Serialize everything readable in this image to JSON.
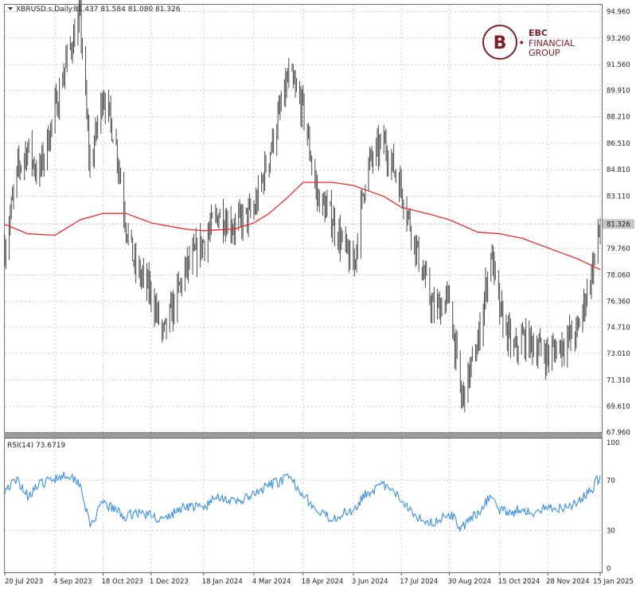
{
  "header": {
    "title": "XBRUSD.s,Daily",
    "ohlc": "81.437 81.584 81.080 81.326"
  },
  "logo": {
    "line1": "EBC",
    "line2": "FINANCIAL",
    "line3": "GROUP"
  },
  "colors": {
    "background": "#ffffff",
    "candles": "#4a4a4a",
    "moving_average": "#e03030",
    "rsi": "#3b8fe0",
    "grid": "#c8c8c8",
    "logo": "#7a1f2b",
    "current_price_tag": "#c6c6c6"
  },
  "chart_data": [
    {
      "type": "line",
      "title": "XBRUSD.s,Daily",
      "current_price_label": "81.326",
      "y_ticks": [
        "94.960",
        "93.260",
        "91.560",
        "89.910",
        "88.210",
        "86.510",
        "84.810",
        "83.110",
        "81.326",
        "79.760",
        "78.060",
        "76.360",
        "74.710",
        "73.010",
        "71.310",
        "69.610",
        "67.960"
      ],
      "ylim": [
        67.96,
        95.4
      ],
      "x_ticks": [
        "20 Jul 2023",
        "4 Sep 2023",
        "18 Oct 2023",
        "1 Dec 2023",
        "18 Jan 2024",
        "4 Mar 2024",
        "18 Apr 2024",
        "3 Jun 2024",
        "17 Jul 2024",
        "30 Aug 2024",
        "15 Oct 2024",
        "28 Nov 2024",
        "15 Jan 2025"
      ],
      "grid": true,
      "series": [
        {
          "name": "",
          "style": "ohlc-bars",
          "x": [
            "2023-07-20",
            "2023-08-01",
            "2023-08-10",
            "2023-08-20",
            "2023-09-04",
            "2023-09-15",
            "2023-09-27",
            "2023-10-06",
            "2023-10-18",
            "2023-10-30",
            "2023-11-08",
            "2023-11-16",
            "2023-12-01",
            "2023-12-12",
            "2024-01-01",
            "2024-01-18",
            "2024-02-01",
            "2024-02-15",
            "2024-03-04",
            "2024-03-18",
            "2024-04-05",
            "2024-04-18",
            "2024-05-01",
            "2024-05-15",
            "2024-06-03",
            "2024-06-15",
            "2024-07-01",
            "2024-07-17",
            "2024-08-01",
            "2024-08-15",
            "2024-08-30",
            "2024-09-10",
            "2024-09-25",
            "2024-10-07",
            "2024-10-15",
            "2024-10-28",
            "2024-11-05",
            "2024-11-15",
            "2024-11-28",
            "2024-12-10",
            "2024-12-25",
            "2025-01-08",
            "2025-01-15"
          ],
          "values": [
            79.8,
            84.8,
            86.2,
            84.4,
            88.6,
            92.0,
            94.6,
            84.9,
            89.8,
            86.4,
            81.3,
            78.6,
            76.9,
            74.1,
            78.3,
            80.2,
            82.0,
            81.2,
            82.1,
            85.8,
            90.8,
            88.7,
            83.1,
            81.6,
            78.4,
            84.9,
            86.6,
            83.6,
            79.4,
            75.8,
            76.5,
            70.0,
            73.6,
            79.6,
            75.7,
            73.1,
            74.0,
            73.6,
            72.9,
            73.6,
            74.4,
            78.5,
            81.3
          ]
        },
        {
          "name": "",
          "style": "moving-average",
          "x": [
            "2023-07-20",
            "2023-08-10",
            "2023-09-04",
            "2023-09-27",
            "2023-10-18",
            "2023-11-08",
            "2023-12-01",
            "2024-01-01",
            "2024-01-18",
            "2024-02-15",
            "2024-03-04",
            "2024-03-18",
            "2024-04-05",
            "2024-04-18",
            "2024-05-15",
            "2024-06-03",
            "2024-07-01",
            "2024-07-17",
            "2024-08-15",
            "2024-08-30",
            "2024-09-25",
            "2024-10-15",
            "2024-11-05",
            "2024-11-28",
            "2024-12-25",
            "2025-01-15"
          ],
          "values": [
            81.3,
            80.7,
            80.6,
            81.6,
            82.0,
            82.0,
            81.4,
            81.0,
            80.9,
            81.0,
            81.4,
            82.0,
            83.1,
            84.0,
            84.0,
            83.8,
            83.1,
            82.4,
            81.9,
            81.6,
            80.8,
            80.7,
            80.4,
            79.8,
            79.1,
            78.4
          ]
        }
      ]
    },
    {
      "type": "line",
      "title": "RSI(14) 73.6719",
      "y_ticks": [
        "100",
        "70",
        "30",
        "0"
      ],
      "ylim": [
        0,
        100
      ],
      "grid": true,
      "series": [
        {
          "name": "",
          "x": [
            "2023-07-20",
            "2023-08-01",
            "2023-08-10",
            "2023-08-20",
            "2023-09-04",
            "2023-09-15",
            "2023-09-27",
            "2023-10-06",
            "2023-10-18",
            "2023-10-30",
            "2023-11-08",
            "2023-11-16",
            "2023-12-01",
            "2023-12-12",
            "2024-01-01",
            "2024-01-18",
            "2024-02-01",
            "2024-02-15",
            "2024-03-04",
            "2024-03-18",
            "2024-04-05",
            "2024-04-18",
            "2024-05-01",
            "2024-05-15",
            "2024-06-03",
            "2024-06-15",
            "2024-07-01",
            "2024-07-17",
            "2024-08-01",
            "2024-08-15",
            "2024-08-30",
            "2024-09-10",
            "2024-09-25",
            "2024-10-07",
            "2024-10-15",
            "2024-10-28",
            "2024-11-05",
            "2024-11-15",
            "2024-11-28",
            "2024-12-10",
            "2024-12-25",
            "2025-01-08",
            "2025-01-15"
          ],
          "values": [
            63,
            70,
            58,
            66,
            72,
            75,
            68,
            33,
            52,
            46,
            40,
            45,
            42,
            38,
            50,
            48,
            58,
            52,
            58,
            66,
            72,
            60,
            44,
            40,
            47,
            60,
            66,
            55,
            41,
            36,
            44,
            32,
            44,
            58,
            46,
            45,
            48,
            42,
            49,
            48,
            52,
            64,
            73.7
          ]
        }
      ]
    }
  ]
}
